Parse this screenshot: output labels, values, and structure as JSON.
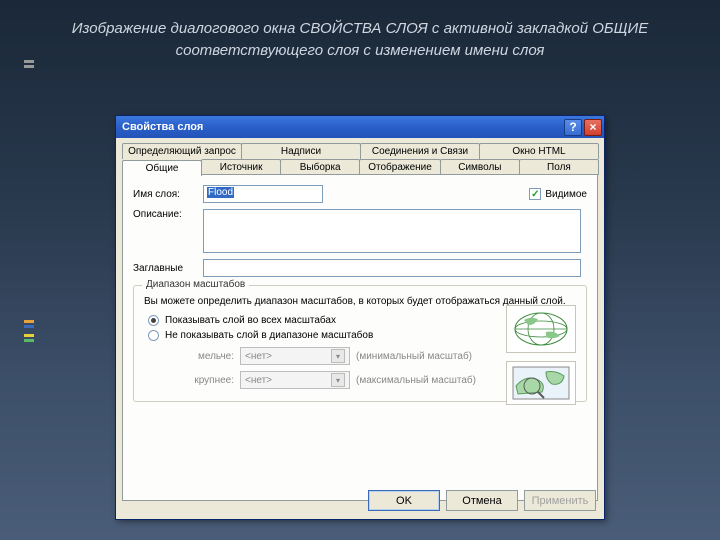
{
  "caption": "Изображение диалогового окна СВОЙСТВА СЛОЯ с активной закладкой ОБЩИЕ соответствующего слоя с изменением имени слоя",
  "dialog": {
    "title": "Свойства слоя",
    "tabs_top": [
      "Определяющий запрос",
      "Надписи",
      "Соединения и Связи",
      "Окно HTML"
    ],
    "tabs_bottom": [
      "Общие",
      "Источник",
      "Выборка",
      "Отображение",
      "Символы",
      "Поля"
    ],
    "active_tab": "Общие",
    "labels": {
      "name": "Имя слоя:",
      "desc": "Описание:",
      "caption_words": "Заглавные",
      "visible": "Видимое"
    },
    "name_value": "Flood",
    "group": {
      "title": "Диапазон масштабов",
      "info": "Вы можете определить диапазон масштабов, в которых будет отображаться данный слой.",
      "radio1": "Показывать слой во всех масштабах",
      "radio2": "Не показывать слой в диапазоне масштабов",
      "smaller_label": "мельче:",
      "larger_label": "крупнее:",
      "none_value": "<нет>",
      "min_hint": "(минимальный масштаб)",
      "max_hint": "(максимальный масштаб)"
    },
    "buttons": {
      "ok": "OK",
      "cancel": "Отмена",
      "apply": "Применить"
    }
  }
}
